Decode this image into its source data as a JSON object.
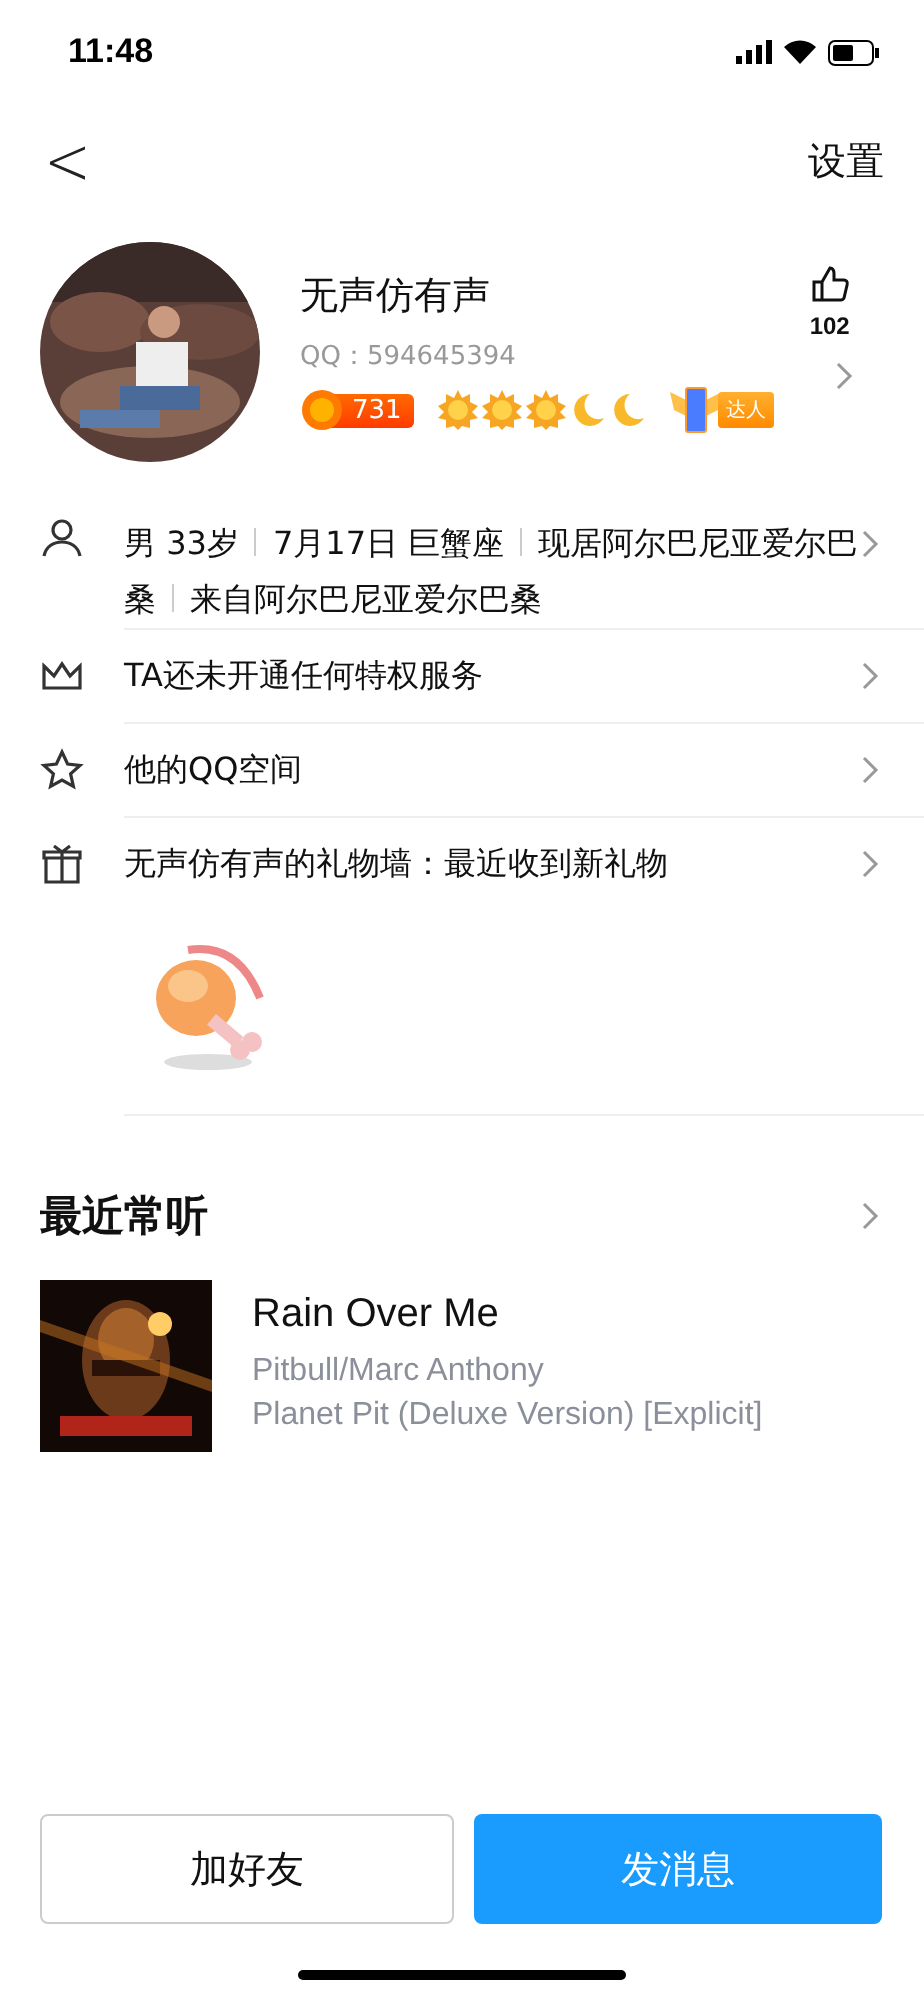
{
  "status_bar": {
    "time": "11:48"
  },
  "nav": {
    "back": "<",
    "settings": "设置"
  },
  "profile": {
    "name": "无声仿有声",
    "qq": "QQ：594645394",
    "level_number": "731",
    "level_icons": [
      {
        "kind": "sun"
      },
      {
        "kind": "sun"
      },
      {
        "kind": "sun"
      },
      {
        "kind": "moon"
      },
      {
        "kind": "moon"
      }
    ],
    "badge": "达人",
    "likes": "102"
  },
  "details": {
    "segments": [
      "男 33岁",
      "7月17日 巨蟹座",
      "现居阿尔巴尼亚爱尔巴桑",
      "来自阿尔巴尼亚爱尔巴桑"
    ]
  },
  "menu": [
    {
      "kind": "crown",
      "label": "TA还未开通任何特权服务"
    },
    {
      "kind": "star",
      "label": "他的QQ空间"
    },
    {
      "kind": "gift",
      "label": "无声仿有声的礼物墙：最近收到新礼物"
    }
  ],
  "recent": {
    "title": "最近常听",
    "song": {
      "title": "Rain Over Me",
      "artist": "Pitbull/Marc Anthony",
      "album": "Planet Pit (Deluxe Version) [Explicit]"
    }
  },
  "buttons": [
    {
      "kind": "secondary",
      "label": "加好友"
    },
    {
      "kind": "primary",
      "label": "发消息"
    }
  ]
}
